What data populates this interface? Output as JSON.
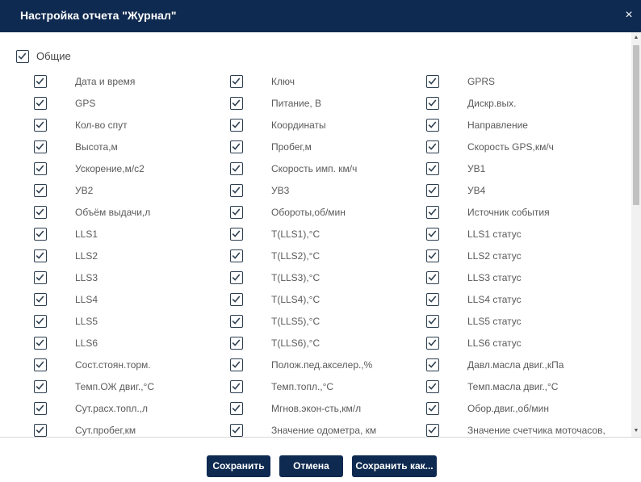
{
  "dialog": {
    "title": "Настройка отчета \"Журнал\"",
    "close_glyph": "×"
  },
  "group": {
    "label": "Общие",
    "checked": true
  },
  "columns": [
    {
      "items": [
        {
          "label": "Дата и время",
          "checked": true
        },
        {
          "label": "GPS",
          "checked": true
        },
        {
          "label": "Кол-во спут",
          "checked": true
        },
        {
          "label": "Высота,м",
          "checked": true
        },
        {
          "label": "Ускорение,м/с2",
          "checked": true
        },
        {
          "label": "УВ2",
          "checked": true
        },
        {
          "label": "Объём выдачи,л",
          "checked": true
        },
        {
          "label": "LLS1",
          "checked": true
        },
        {
          "label": "LLS2",
          "checked": true
        },
        {
          "label": "LLS3",
          "checked": true
        },
        {
          "label": "LLS4",
          "checked": true
        },
        {
          "label": "LLS5",
          "checked": true
        },
        {
          "label": "LLS6",
          "checked": true
        },
        {
          "label": "Сост.стоян.торм.",
          "checked": true
        },
        {
          "label": "Темп.ОЖ двиг.,°С",
          "checked": true
        },
        {
          "label": "Сут.расх.топл.,л",
          "checked": true
        },
        {
          "label": "Сут.пробег,км",
          "checked": true
        }
      ]
    },
    {
      "items": [
        {
          "label": "Ключ",
          "checked": true
        },
        {
          "label": "Питание, В",
          "checked": true
        },
        {
          "label": "Координаты",
          "checked": true
        },
        {
          "label": "Пробег,м",
          "checked": true
        },
        {
          "label": "Скорость имп. км/ч",
          "checked": true
        },
        {
          "label": "УВ3",
          "checked": true
        },
        {
          "label": "Обороты,об/мин",
          "checked": true
        },
        {
          "label": "T(LLS1),°C",
          "checked": true
        },
        {
          "label": "T(LLS2),°C",
          "checked": true
        },
        {
          "label": "T(LLS3),°C",
          "checked": true
        },
        {
          "label": "T(LLS4),°C",
          "checked": true
        },
        {
          "label": "T(LLS5),°C",
          "checked": true
        },
        {
          "label": "T(LLS6),°C",
          "checked": true
        },
        {
          "label": "Полож.пед.акселер.,%",
          "checked": true
        },
        {
          "label": "Темп.топл.,°С",
          "checked": true
        },
        {
          "label": "Мгнов.экон-сть,км/л",
          "checked": true
        },
        {
          "label": "Значение одометра, км",
          "checked": true
        }
      ]
    },
    {
      "items": [
        {
          "label": "GPRS",
          "checked": true
        },
        {
          "label": "Дискр.вых.",
          "checked": true
        },
        {
          "label": "Направление",
          "checked": true
        },
        {
          "label": "Скорость GPS,км/ч",
          "checked": true
        },
        {
          "label": "УВ1",
          "checked": true
        },
        {
          "label": "УВ4",
          "checked": true
        },
        {
          "label": "Источник события",
          "checked": true
        },
        {
          "label": "LLS1 статус",
          "checked": true
        },
        {
          "label": "LLS2 статус",
          "checked": true
        },
        {
          "label": "LLS3 статус",
          "checked": true
        },
        {
          "label": "LLS4 статус",
          "checked": true
        },
        {
          "label": "LLS5 статус",
          "checked": true
        },
        {
          "label": "LLS6 статус",
          "checked": true
        },
        {
          "label": "Давл.масла двиг.,кПа",
          "checked": true
        },
        {
          "label": "Темп.масла двиг.,°С",
          "checked": true
        },
        {
          "label": "Обор.двиг.,об/мин",
          "checked": true
        },
        {
          "label": "Значение счетчика моточасов,",
          "checked": true
        }
      ]
    }
  ],
  "footer": {
    "save_label": "Сохранить",
    "cancel_label": "Отмена",
    "save_as_label": "Сохранить как..."
  },
  "scrollbar": {
    "up_glyph": "▲",
    "down_glyph": "▼"
  },
  "colors": {
    "header_bg": "#0f2a50",
    "button_bg": "#0f2a50",
    "checkbox_border": "#2c3e50"
  }
}
